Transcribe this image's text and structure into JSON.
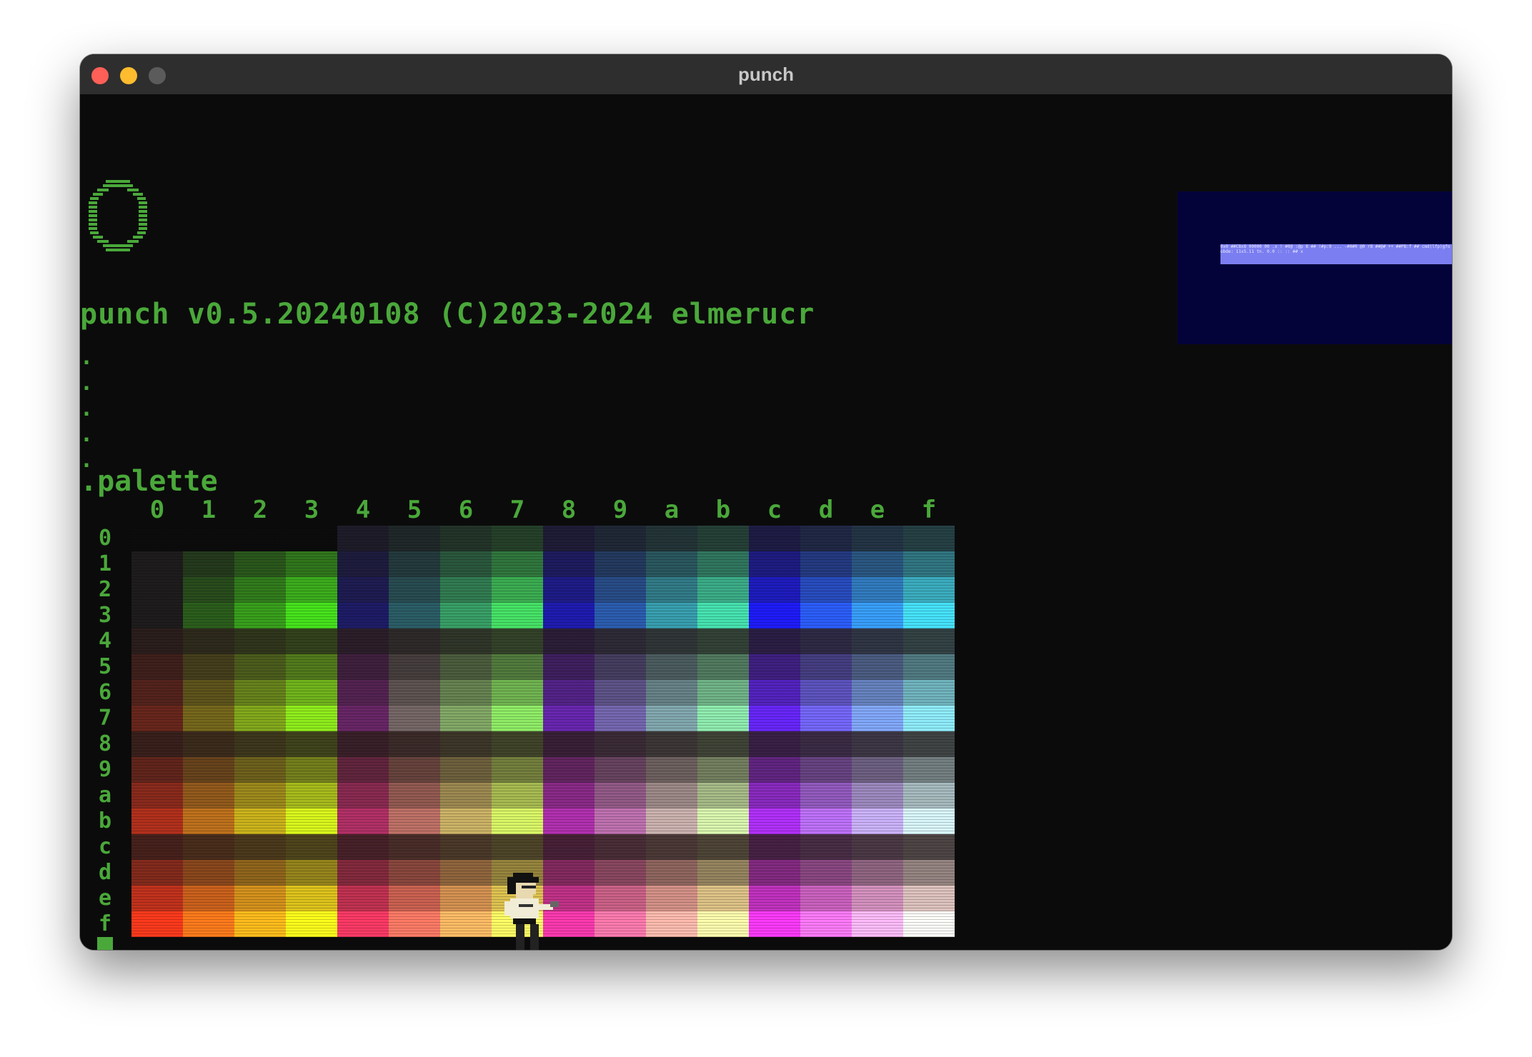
{
  "window": {
    "title": "punch",
    "controls": [
      "close",
      "minimize",
      "zoom"
    ]
  },
  "terminal": {
    "logo_icon": "punch-ring-logo",
    "banner": "punch v0.5.20240108 (C)2023-2024 elmerucr",
    "prompt_lines": [
      ".",
      ".",
      ".",
      ".",
      "."
    ],
    "command": ".palette",
    "cursor_prompt": ".",
    "text_color": "#4aa83a",
    "background_color": "#0b0b0b"
  },
  "palette": {
    "column_labels": [
      "0",
      "1",
      "2",
      "3",
      "4",
      "5",
      "6",
      "7",
      "8",
      "9",
      "a",
      "b",
      "c",
      "d",
      "e",
      "f"
    ],
    "row_labels": [
      "0",
      "1",
      "2",
      "3",
      "4",
      "5",
      "6",
      "7",
      "8",
      "9",
      "a",
      "b",
      "c",
      "d",
      "e",
      "f"
    ]
  },
  "mini_view": {
    "background_color": "#03033a",
    "text": "0x0 ##C8x8 00000 00 .x ! #0@ :@p 8 ## !#p:9 ... -#H#0 @0 r8 ##@# ++ ##PB:f ## cmd(lfp)gfoobde: 11x5.11 tn. 0.0 :: :: ## x"
  },
  "character_icon": "pixel-character-sprite"
}
